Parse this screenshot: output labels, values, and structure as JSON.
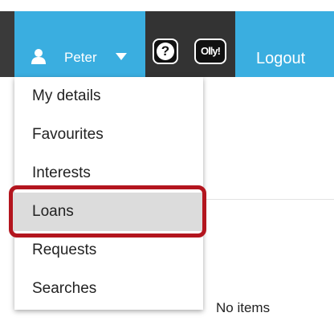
{
  "header": {
    "user_name": "Peter",
    "help_label": "?",
    "olly_label": "Olly!",
    "logout_label": "Logout"
  },
  "user_menu": {
    "items": [
      {
        "label": "My details"
      },
      {
        "label": "Favourites"
      },
      {
        "label": "Interests"
      },
      {
        "label": "Loans",
        "highlighted": true
      },
      {
        "label": "Requests"
      },
      {
        "label": "Searches"
      }
    ]
  },
  "main": {
    "empty_message": "No items"
  },
  "colors": {
    "accent": "#3aaee0",
    "dark_bar": "#333333",
    "highlight": "#dcdcdc",
    "annotation": "#b3151e"
  }
}
